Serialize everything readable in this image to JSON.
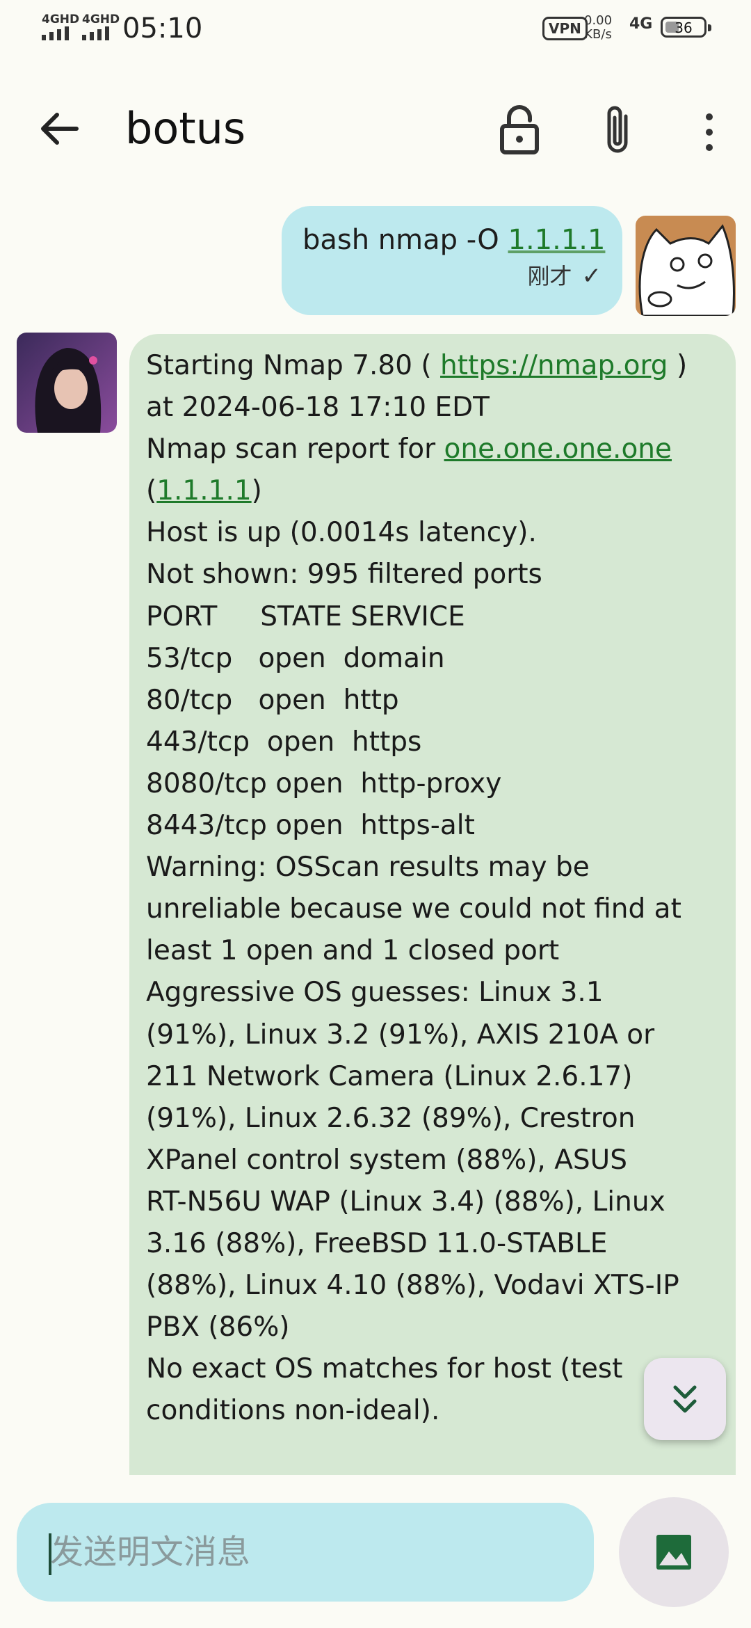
{
  "status_bar": {
    "sim1": "4GHD",
    "sim2": "4GHD",
    "time": "05:10",
    "vpn": "VPN",
    "speed_value": "0.00",
    "speed_unit": "KB/s",
    "network": "4G",
    "battery_level": "36",
    "battery_fraction": 0.36
  },
  "app_bar": {
    "title": "botus",
    "icons": [
      "back-arrow-icon",
      "lock-open-icon",
      "attach-icon",
      "more-vert-icon"
    ]
  },
  "outgoing_message": {
    "command": "bash nmap -O ",
    "target_link": "1.1.1.1",
    "time": "刚才",
    "status_icon": "check-icon"
  },
  "incoming_message": {
    "lines": [
      {
        "pre": "Starting Nmap 7.80 ( ",
        "link": "https://nmap.org",
        "post": " )"
      },
      {
        "pre": "at 2024-06-18 17:10 EDT",
        "link": "",
        "post": ""
      },
      {
        "pre": "Nmap scan report for ",
        "link": "one.one.one.one",
        "post": ""
      },
      {
        "pre": "(",
        "link": "1.1.1.1",
        "post": ")"
      },
      {
        "pre": "Host is up (0.0014s latency).",
        "link": "",
        "post": ""
      },
      {
        "pre": "Not shown: 995 filtered ports",
        "link": "",
        "post": ""
      },
      {
        "pre": "PORT     STATE SERVICE",
        "link": "",
        "post": ""
      },
      {
        "pre": "53/tcp   open  domain",
        "link": "",
        "post": ""
      },
      {
        "pre": "80/tcp   open  http",
        "link": "",
        "post": ""
      },
      {
        "pre": "443/tcp  open  https",
        "link": "",
        "post": ""
      },
      {
        "pre": "8080/tcp open  http-proxy",
        "link": "",
        "post": ""
      },
      {
        "pre": "8443/tcp open  https-alt",
        "link": "",
        "post": ""
      },
      {
        "pre": "Warning: OSScan results may be",
        "link": "",
        "post": ""
      },
      {
        "pre": "unreliable because we could not find at",
        "link": "",
        "post": ""
      },
      {
        "pre": "least 1 open and 1 closed port",
        "link": "",
        "post": ""
      },
      {
        "pre": "Aggressive OS guesses: Linux 3.1",
        "link": "",
        "post": ""
      },
      {
        "pre": "(91%), Linux 3.2 (91%), AXIS 210A or",
        "link": "",
        "post": ""
      },
      {
        "pre": "211 Network Camera (Linux 2.6.17)",
        "link": "",
        "post": ""
      },
      {
        "pre": "(91%), Linux 2.6.32 (89%), Crestron",
        "link": "",
        "post": ""
      },
      {
        "pre": "XPanel control system (88%), ASUS",
        "link": "",
        "post": ""
      },
      {
        "pre": "RT-N56U WAP (Linux 3.4) (88%), Linux",
        "link": "",
        "post": ""
      },
      {
        "pre": "3.16 (88%), FreeBSD 11.0-STABLE",
        "link": "",
        "post": ""
      },
      {
        "pre": "(88%), Linux 4.10 (88%), Vodavi XTS-IP",
        "link": "",
        "post": ""
      },
      {
        "pre": "PBX (86%)",
        "link": "",
        "post": ""
      },
      {
        "pre": "No exact OS matches for host (test",
        "link": "",
        "post": ""
      },
      {
        "pre": "conditions non-ideal).",
        "link": "",
        "post": ""
      }
    ]
  },
  "scroll_button": {
    "icon": "double-chevron-down-icon"
  },
  "composer": {
    "placeholder": "发送明文消息",
    "image_button_icon": "image-icon"
  },
  "colors": {
    "outgoing_bubble": "#bde9ee",
    "incoming_bubble": "#d6e8d3",
    "link": "#1e7a2a",
    "background": "#fbfbf5"
  }
}
